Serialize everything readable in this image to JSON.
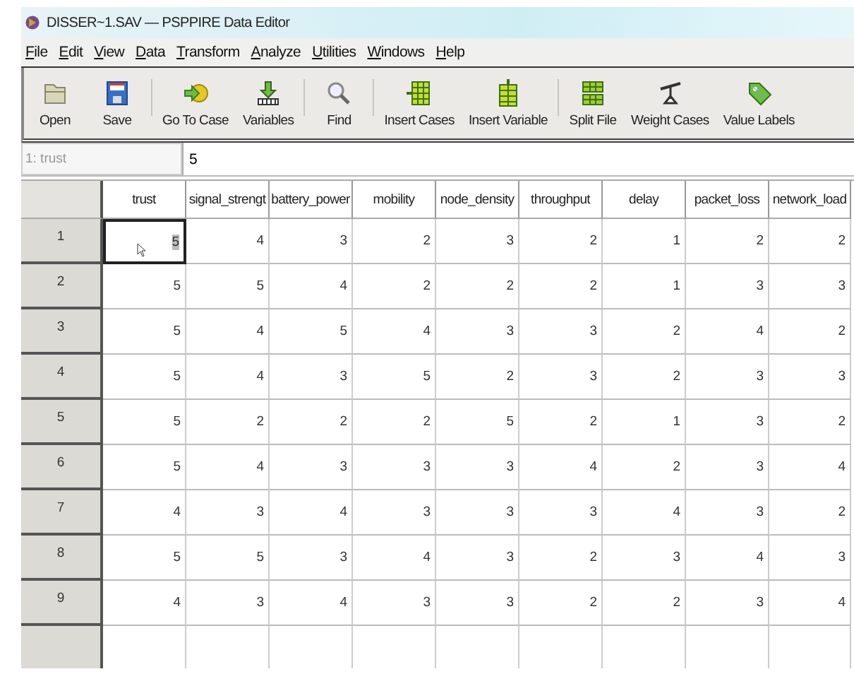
{
  "window": {
    "title": "DISSER~1.SAV — PSPPIRE Data Editor"
  },
  "menu": [
    "File",
    "Edit",
    "View",
    "Data",
    "Transform",
    "Analyze",
    "Utilities",
    "Windows",
    "Help"
  ],
  "toolbar": [
    [
      {
        "label": "Open"
      },
      {
        "label": "Save"
      }
    ],
    [
      {
        "label": "Go To Case"
      },
      {
        "label": "Variables"
      }
    ],
    [
      {
        "label": "Find"
      }
    ],
    [
      {
        "label": "Insert Cases"
      },
      {
        "label": "Insert Variable"
      }
    ],
    [
      {
        "label": "Split File"
      },
      {
        "label": "Weight Cases"
      },
      {
        "label": "Value Labels"
      }
    ]
  ],
  "cell_reference": {
    "name": "1: trust",
    "value": "5"
  },
  "table": {
    "columns": [
      "trust",
      "signal_strengt",
      "battery_power",
      "mobility",
      "node_density",
      "throughput",
      "delay",
      "packet_loss",
      "network_load"
    ],
    "rows": [
      {
        "label": "1",
        "cells": [
          {
            "value": "5",
            "selected": true
          },
          {
            "value": "4",
            "selected": false
          },
          {
            "value": "3",
            "selected": false
          },
          {
            "value": "2",
            "selected": false
          },
          {
            "value": "3",
            "selected": false
          },
          {
            "value": "2",
            "selected": false
          },
          {
            "value": "1",
            "selected": false
          },
          {
            "value": "2",
            "selected": false
          },
          {
            "value": "2",
            "selected": false
          }
        ]
      },
      {
        "label": "2",
        "cells": [
          {
            "value": "5",
            "selected": false
          },
          {
            "value": "5",
            "selected": false
          },
          {
            "value": "4",
            "selected": false
          },
          {
            "value": "2",
            "selected": false
          },
          {
            "value": "2",
            "selected": false
          },
          {
            "value": "2",
            "selected": false
          },
          {
            "value": "1",
            "selected": false
          },
          {
            "value": "3",
            "selected": false
          },
          {
            "value": "3",
            "selected": false
          }
        ]
      },
      {
        "label": "3",
        "cells": [
          {
            "value": "5",
            "selected": false
          },
          {
            "value": "4",
            "selected": false
          },
          {
            "value": "5",
            "selected": false
          },
          {
            "value": "4",
            "selected": false
          },
          {
            "value": "3",
            "selected": false
          },
          {
            "value": "3",
            "selected": false
          },
          {
            "value": "2",
            "selected": false
          },
          {
            "value": "4",
            "selected": false
          },
          {
            "value": "2",
            "selected": false
          }
        ]
      },
      {
        "label": "4",
        "cells": [
          {
            "value": "5",
            "selected": false
          },
          {
            "value": "4",
            "selected": false
          },
          {
            "value": "3",
            "selected": false
          },
          {
            "value": "5",
            "selected": false
          },
          {
            "value": "2",
            "selected": false
          },
          {
            "value": "3",
            "selected": false
          },
          {
            "value": "2",
            "selected": false
          },
          {
            "value": "3",
            "selected": false
          },
          {
            "value": "3",
            "selected": false
          }
        ]
      },
      {
        "label": "5",
        "cells": [
          {
            "value": "5",
            "selected": false
          },
          {
            "value": "2",
            "selected": false
          },
          {
            "value": "2",
            "selected": false
          },
          {
            "value": "2",
            "selected": false
          },
          {
            "value": "5",
            "selected": false
          },
          {
            "value": "2",
            "selected": false
          },
          {
            "value": "1",
            "selected": false
          },
          {
            "value": "3",
            "selected": false
          },
          {
            "value": "2",
            "selected": false
          }
        ]
      },
      {
        "label": "6",
        "cells": [
          {
            "value": "5",
            "selected": false
          },
          {
            "value": "4",
            "selected": false
          },
          {
            "value": "3",
            "selected": false
          },
          {
            "value": "3",
            "selected": false
          },
          {
            "value": "3",
            "selected": false
          },
          {
            "value": "4",
            "selected": false
          },
          {
            "value": "2",
            "selected": false
          },
          {
            "value": "3",
            "selected": false
          },
          {
            "value": "4",
            "selected": false
          }
        ]
      },
      {
        "label": "7",
        "cells": [
          {
            "value": "4",
            "selected": false
          },
          {
            "value": "3",
            "selected": false
          },
          {
            "value": "4",
            "selected": false
          },
          {
            "value": "3",
            "selected": false
          },
          {
            "value": "3",
            "selected": false
          },
          {
            "value": "3",
            "selected": false
          },
          {
            "value": "4",
            "selected": false
          },
          {
            "value": "3",
            "selected": false
          },
          {
            "value": "2",
            "selected": false
          }
        ]
      },
      {
        "label": "8",
        "cells": [
          {
            "value": "5",
            "selected": false
          },
          {
            "value": "5",
            "selected": false
          },
          {
            "value": "3",
            "selected": false
          },
          {
            "value": "4",
            "selected": false
          },
          {
            "value": "3",
            "selected": false
          },
          {
            "value": "2",
            "selected": false
          },
          {
            "value": "3",
            "selected": false
          },
          {
            "value": "4",
            "selected": false
          },
          {
            "value": "3",
            "selected": false
          }
        ]
      },
      {
        "label": "9",
        "cells": [
          {
            "value": "4",
            "selected": false
          },
          {
            "value": "3",
            "selected": false
          },
          {
            "value": "4",
            "selected": false
          },
          {
            "value": "3",
            "selected": false
          },
          {
            "value": "3",
            "selected": false
          },
          {
            "value": "2",
            "selected": false
          },
          {
            "value": "2",
            "selected": false
          },
          {
            "value": "3",
            "selected": false
          },
          {
            "value": "4",
            "selected": false
          }
        ]
      }
    ]
  }
}
